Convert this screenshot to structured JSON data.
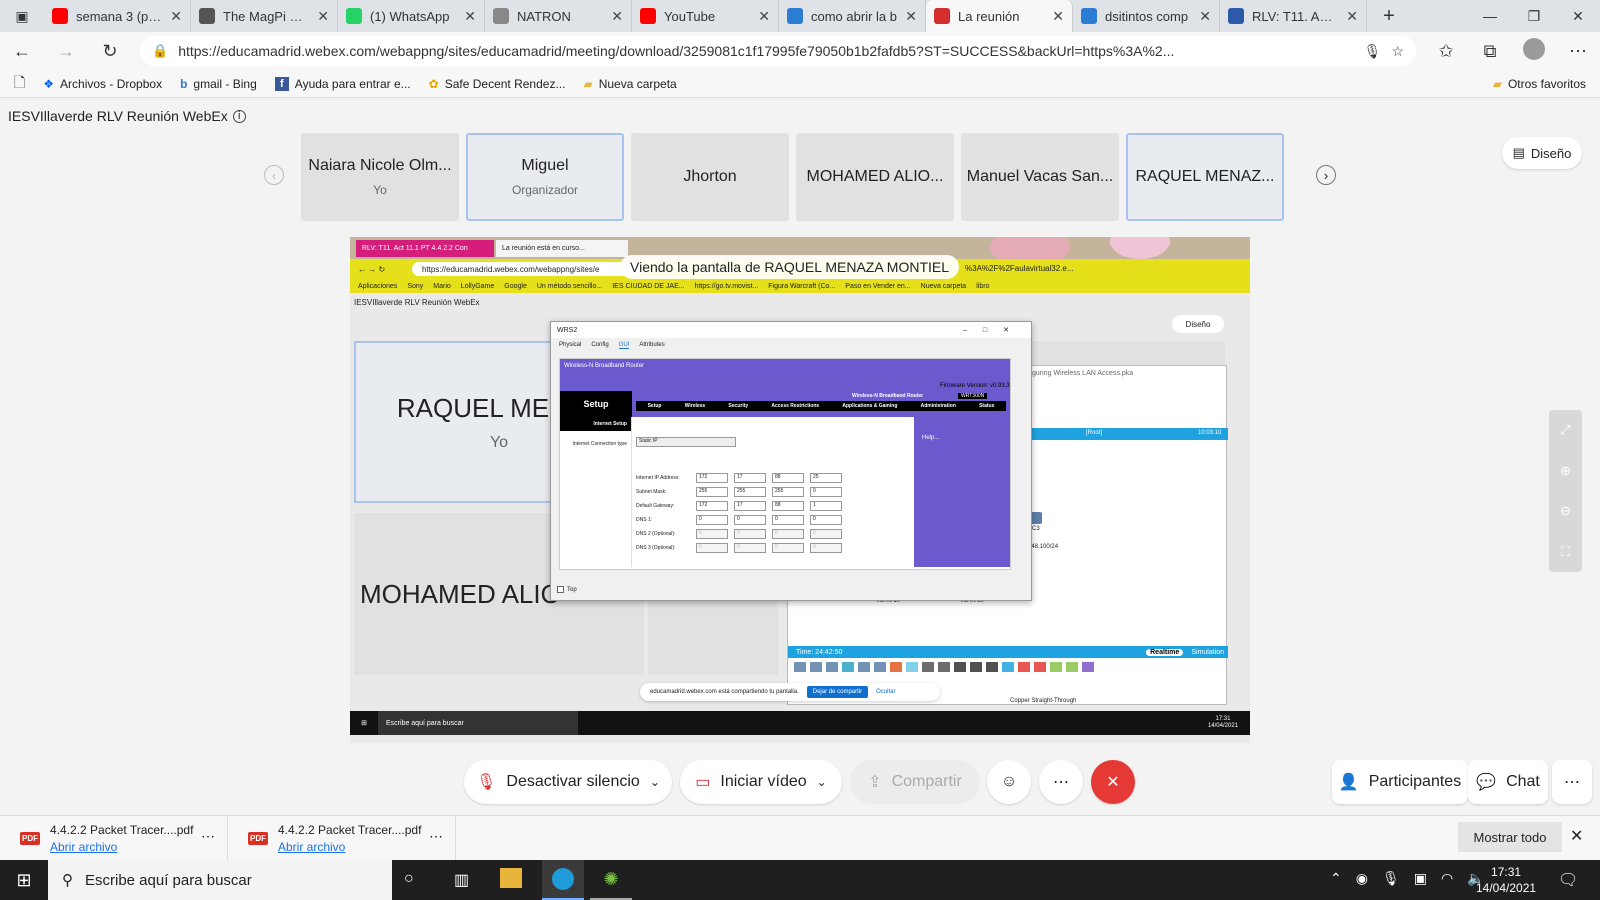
{
  "tabs": [
    {
      "title": "semana 3 (pico",
      "icon": "youtube-icon",
      "color": "#ff0000"
    },
    {
      "title": "The MagPi mag",
      "icon": "magpi-icon",
      "color": "#555555"
    },
    {
      "title": "(1) WhatsApp",
      "icon": "whatsapp-icon",
      "color": "#25d366"
    },
    {
      "title": "NATRON",
      "icon": "natron-icon",
      "color": "#888888"
    },
    {
      "title": "YouTube",
      "icon": "youtube-icon",
      "color": "#ff0000"
    },
    {
      "title": "como abrir la b",
      "icon": "bing-icon",
      "color": "#2b7cd3"
    },
    {
      "title": "La reunión",
      "icon": "webex-icon",
      "color": "#d32f2f",
      "active": true
    },
    {
      "title": "dsitintos comp",
      "icon": "bing-icon",
      "color": "#2b7cd3"
    },
    {
      "title": "RLV: T11. Act 1",
      "icon": "school-icon",
      "color": "#2d5aa8"
    }
  ],
  "address": {
    "url": "https://educamadrid.webex.com/webappng/sites/educamadrid/meeting/download/3259081c1f17995fe79050b1b2fafdb5?ST=SUCCESS&backUrl=https%3A%2..."
  },
  "bookmarks": [
    {
      "label": "Archivos - Dropbox",
      "icon": "dropbox-icon"
    },
    {
      "label": "gmail - Bing",
      "icon": "bing-icon"
    },
    {
      "label": "Ayuda para entrar e...",
      "icon": "facebook-icon"
    },
    {
      "label": "Safe Decent Rendez...",
      "icon": "bee-icon"
    },
    {
      "label": "Nueva carpeta",
      "icon": "folder-icon"
    }
  ],
  "other_favorites": "Otros favoritos",
  "meeting": {
    "title": "IESVIllaverde RLV Reunión WebEx",
    "layout_label": "Diseño",
    "participants": [
      {
        "name": "Naiara Nicole Olm...",
        "role": "Yo"
      },
      {
        "name": "Miguel",
        "role": "Organizador",
        "selected": true
      },
      {
        "name": "Jhorton",
        "role": ""
      },
      {
        "name": "MOHAMED ALIO...",
        "role": ""
      },
      {
        "name": "Manuel Vacas San...",
        "role": ""
      },
      {
        "name": "RAQUEL MENAZ...",
        "role": "",
        "selected": true
      }
    ],
    "viewing_banner": "Viendo la pantalla de RAQUEL MENAZA MONTIEL"
  },
  "shared": {
    "tabs": [
      "RLV: T11. Act 11.1 PT 4.4.2.2 Con",
      "La reunión está en curso..."
    ],
    "url": "https://educamadrid.webex.com/webappng/sites/e",
    "url_tail": "%3A%2F%2Faulavirtual32.e...",
    "bookmarks": [
      "Aplicaciones",
      "Sony",
      "Mario",
      "LollyGame",
      "Google",
      "Un método sencillo...",
      "IES CIUDAD DE JAE...",
      "https://go.tv.movist...",
      "Figura Warcraft (Co...",
      "Paso en Vender en...",
      "Nueva carpeta",
      "libro"
    ],
    "meeting_title": "IESVIllaverde RLV Reunión WebEx",
    "layout_label": "Diseño",
    "tile1_name": "RAQUEL MENAZ",
    "tile1_role": "Yo",
    "tile2_name": "MOHAMED ALIO",
    "wrs2": {
      "title": "WRS2",
      "tabs": [
        "Physical",
        "Config",
        "GUI",
        "Attributes"
      ],
      "banner": "Wireless-N Broadband Router",
      "firmware": "Firmware Version: v0.93.3",
      "product": "Wireless-N Broadband Router",
      "model": "WRT300N",
      "setup": "Setup",
      "nav": [
        "Setup",
        "Wireless",
        "Security",
        "Access Restrictions",
        "Applications & Gaming",
        "Administration",
        "Status"
      ],
      "subnav": [
        "Basic Setup",
        "DDNS",
        "MAC Address Clone",
        "Advanced Routing"
      ],
      "section": "Internet Setup",
      "conn_label": "Internet Connection type",
      "conn_value": "Static IP",
      "help": "Help...",
      "rows": [
        {
          "label": "Internet IP Address:",
          "vals": [
            "172",
            "17",
            "88",
            "25"
          ]
        },
        {
          "label": "Subnet Mask:",
          "vals": [
            "255",
            "255",
            "255",
            "0"
          ]
        },
        {
          "label": "Default Gateway:",
          "vals": [
            "172",
            "17",
            "88",
            "1"
          ]
        },
        {
          "label": "DNS 1:",
          "vals": [
            "0",
            "0",
            "0",
            "0"
          ]
        },
        {
          "label": "DNS 2 (Optional):",
          "vals": [
            "0",
            "0",
            "0",
            "0"
          ]
        },
        {
          "label": "DNS 3 (Optional):",
          "vals": [
            "0",
            "0",
            "0",
            "0"
          ]
        }
      ],
      "top_label": "Top"
    },
    "pt": {
      "title": "guring Wireless LAN Access.pka",
      "root": "[Root]",
      "clock_top": "10:03:10",
      "pc_label": "PC3",
      "pc_ip": "2.17.48.100/24",
      "vlan_a": "VLAN 10",
      "vlan_b": "VLAN 20",
      "time": "Time: 24:42:50",
      "realtime": "Realtime",
      "simulation": "Simulation",
      "cable": "Copper Straight-Through"
    },
    "sharing_notice": "educamadrid.webex.com está compartiendo tu pantalla.",
    "stop_sharing": "Dejar de compartir",
    "hide": "Ocultar",
    "search": "Escribe aquí para buscar",
    "time": "17:31",
    "date": "14/04/2021"
  },
  "controls": {
    "mute": "Desactivar silencio",
    "video": "Iniciar vídeo",
    "share": "Compartir",
    "participants": "Participantes",
    "chat": "Chat"
  },
  "downloads": [
    {
      "name": "4.4.2.2 Packet Tracer....pdf",
      "action": "Abrir archivo"
    },
    {
      "name": "4.4.2.2 Packet Tracer....pdf",
      "action": "Abrir archivo"
    }
  ],
  "show_all": "Mostrar todo",
  "taskbar": {
    "search": "Escribe aquí para buscar",
    "time": "17:31",
    "date": "14/04/2021"
  }
}
